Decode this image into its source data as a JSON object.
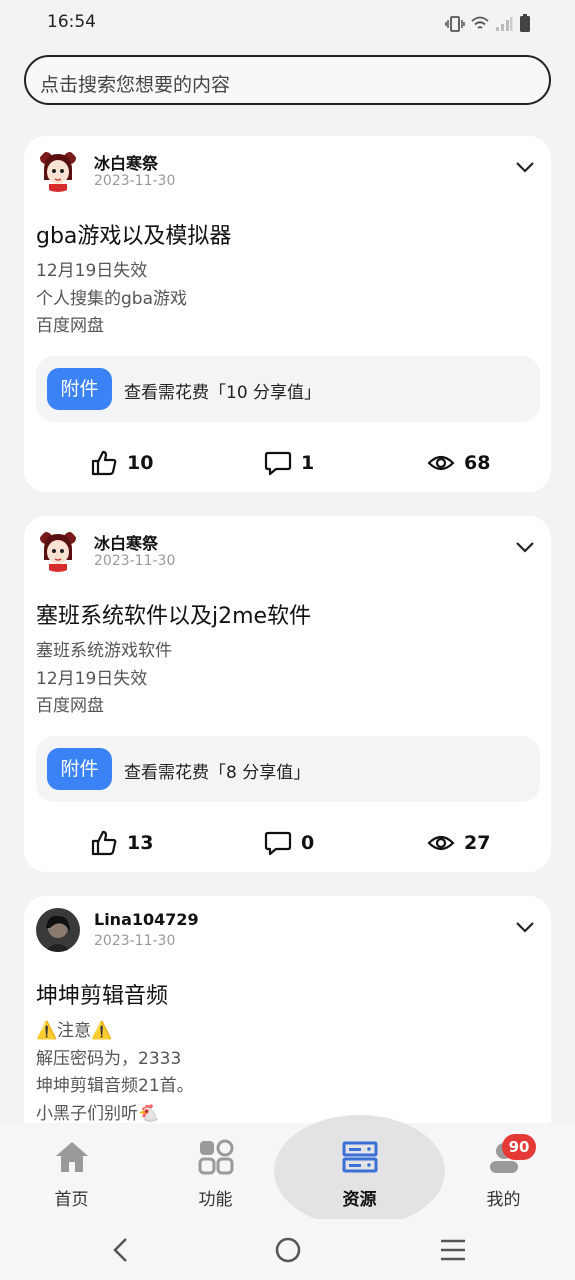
{
  "status_bar": {
    "time": "16:54"
  },
  "search": {
    "placeholder": "点击搜索您想要的内容"
  },
  "posts": [
    {
      "author": "冰白寒祭",
      "date": "2023-11-30",
      "title": "gba游戏以及模拟器",
      "body_lines": [
        "12月19日失效",
        "个人搜集的gba游戏",
        "百度网盘"
      ],
      "attachment_tag": "附件",
      "attachment_text": "查看需花费「10 分享值」",
      "likes": "10",
      "comments": "1",
      "views": "68"
    },
    {
      "author": "冰白寒祭",
      "date": "2023-11-30",
      "title": "塞班系统软件以及j2me软件",
      "body_lines": [
        "塞班系统游戏软件",
        "12月19日失效",
        "百度网盘"
      ],
      "attachment_tag": "附件",
      "attachment_text": "查看需花费「8 分享值」",
      "likes": "13",
      "comments": "0",
      "views": "27"
    },
    {
      "author": "Lina104729",
      "date": "2023-11-30",
      "title": "坤坤剪辑音频",
      "body_lines": [
        "⚠️注意⚠️",
        "解压密码为，2333",
        "坤坤剪辑音频21首。",
        "小黑子们别听🐔"
      ]
    }
  ],
  "nav": {
    "items": [
      {
        "label": "首页",
        "icon": "home-icon"
      },
      {
        "label": "功能",
        "icon": "grid-icon"
      },
      {
        "label": "资源",
        "icon": "server-icon"
      },
      {
        "label": "我的",
        "icon": "user-icon"
      }
    ],
    "active": "资源",
    "badge": "90"
  },
  "colors": {
    "accent": "#3b82f6",
    "badge": "#e53935",
    "active_nav": "#3b6fd8"
  }
}
